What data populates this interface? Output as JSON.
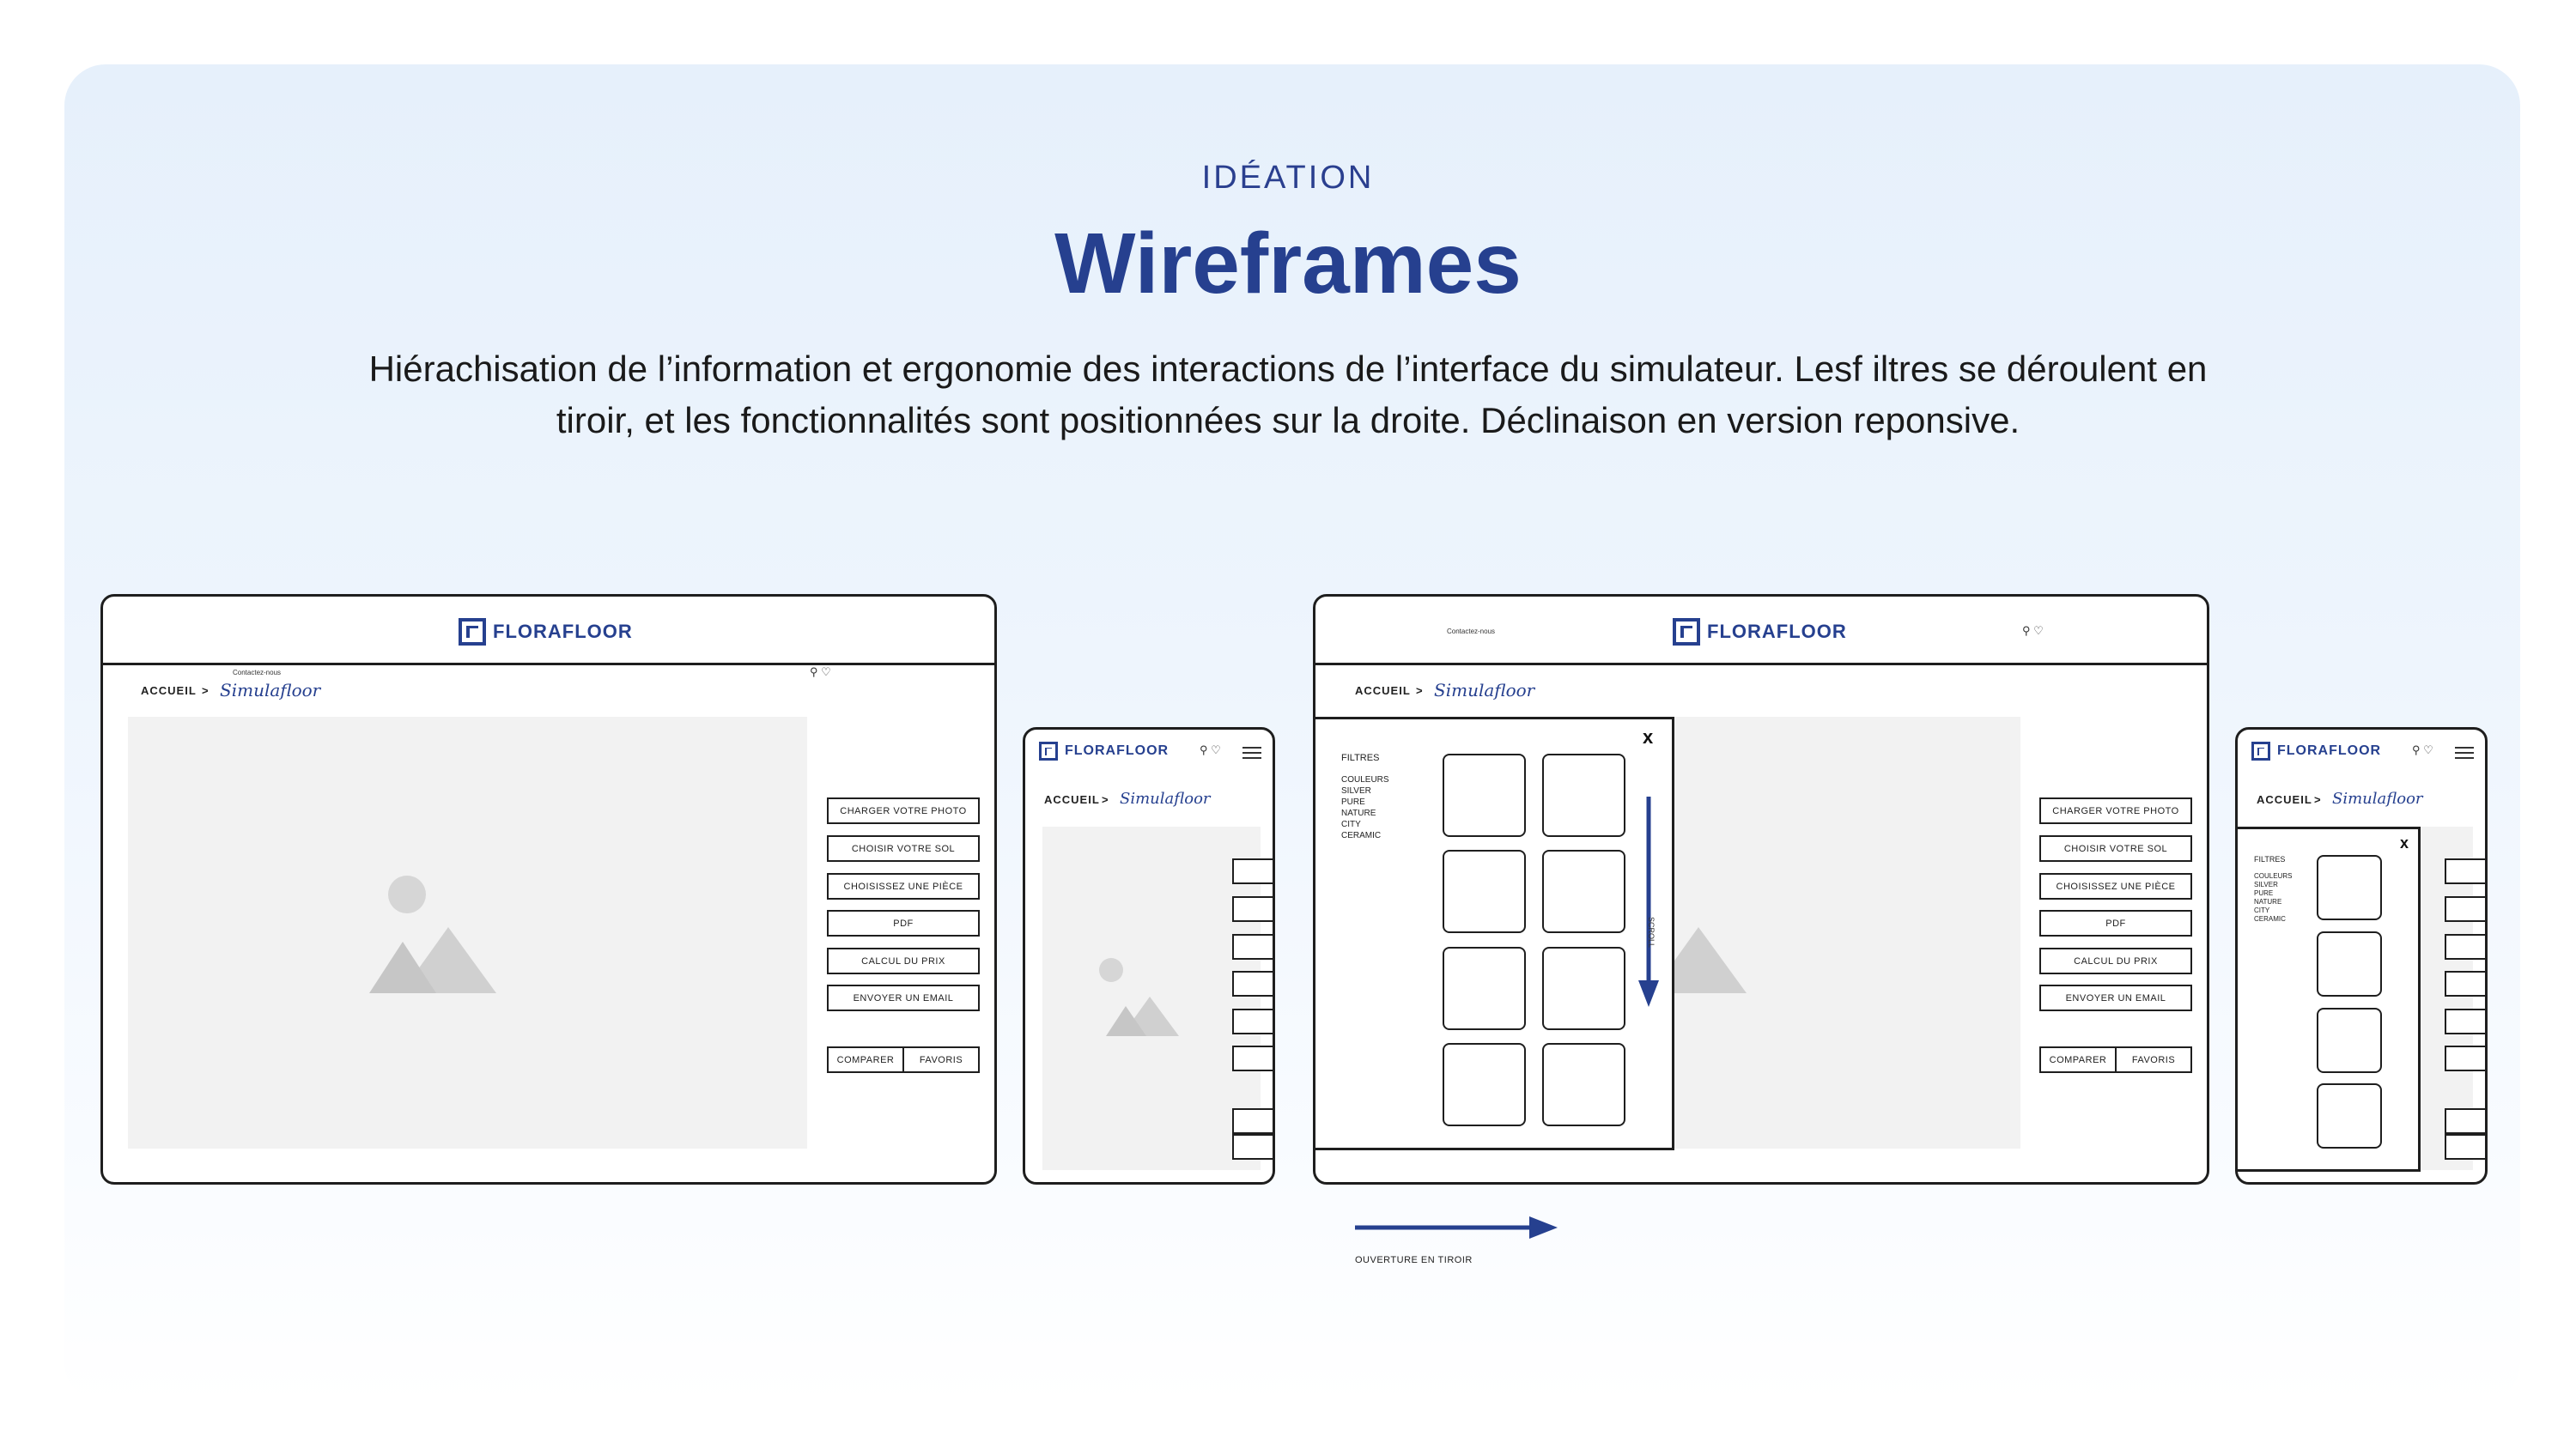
{
  "header": {
    "eyebrow": "IDÉATION",
    "title": "Wireframes",
    "description": "Hiérachisation de l’information et ergonomie des interactions de l’interface du simulateur. Lesf iltres se déroulent en tiroir, et les fonctionnalités sont positionnées sur la droite. Déclinaison en version reponsive."
  },
  "brand": {
    "logo_text": "FLORAFLOOR",
    "script_logo": "Simulafloor"
  },
  "nav": {
    "home": "ACCUEIL",
    "separator": ">",
    "contact": "Contactez-nous",
    "icons": [
      "search-icon",
      "heart-icon"
    ]
  },
  "actions": [
    "CHARGER VOTRE PHOTO",
    "CHOISIR VOTRE SOL",
    "CHOISISSEZ UNE PIÈCE",
    "PDF",
    "CALCUL DU PRIX",
    "ENVOYER UN EMAIL"
  ],
  "bottom_actions": {
    "compare": "COMPARER",
    "favorites": "FAVORIS"
  },
  "filters": {
    "title": "FILTRES",
    "items": [
      "COULEURS",
      "SILVER",
      "PURE",
      "NATURE",
      "CITY",
      "CERAMIC"
    ],
    "close": "x",
    "scroll": "SCROLL"
  },
  "annotation": {
    "drawer_opening": "OUVERTURE EN TIROIR"
  },
  "colors": {
    "brand_blue": "#26408f",
    "placeholder": "#f2f2f2",
    "outline": "#1e1e1e"
  }
}
